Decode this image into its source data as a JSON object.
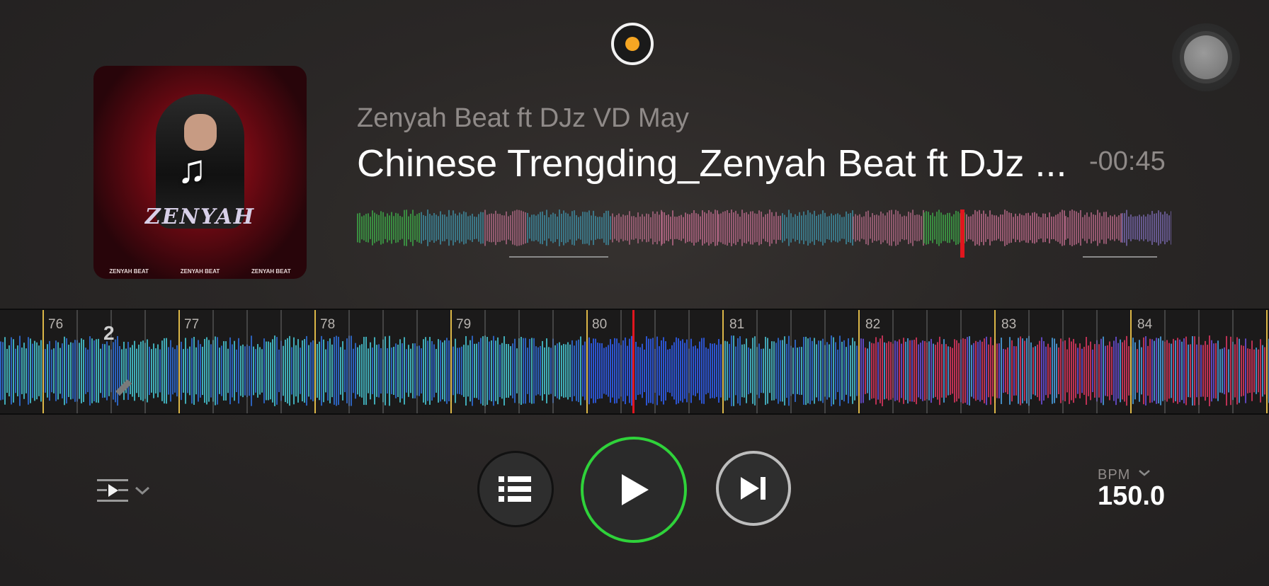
{
  "track": {
    "artist": "Zenyah Beat ft DJz VD May",
    "title": "Chinese Trengding_Zenyah Beat ft DJz ...",
    "remaining": "-00:45",
    "artwork": {
      "logo_text": "ZENYAH",
      "footer": [
        "ZENYAH BEAT",
        "ZENYAH BEAT",
        "ZENYAH BEAT"
      ]
    }
  },
  "deck": {
    "beat_markers": [
      "76",
      "77",
      "78",
      "79",
      "80",
      "81",
      "82",
      "83",
      "84"
    ],
    "cue_number": "2"
  },
  "controls": {
    "queue": "list-icon",
    "play": "play-icon",
    "next": "skip-next-icon",
    "mode": "playlist-play-icon"
  },
  "bpm": {
    "label": "BPM",
    "value": "150.0"
  },
  "colors": {
    "play_ring": "#2fd23a",
    "playhead": "#e0161e",
    "beat_marker": "#f2c94c",
    "indicator": "#f5a623"
  }
}
